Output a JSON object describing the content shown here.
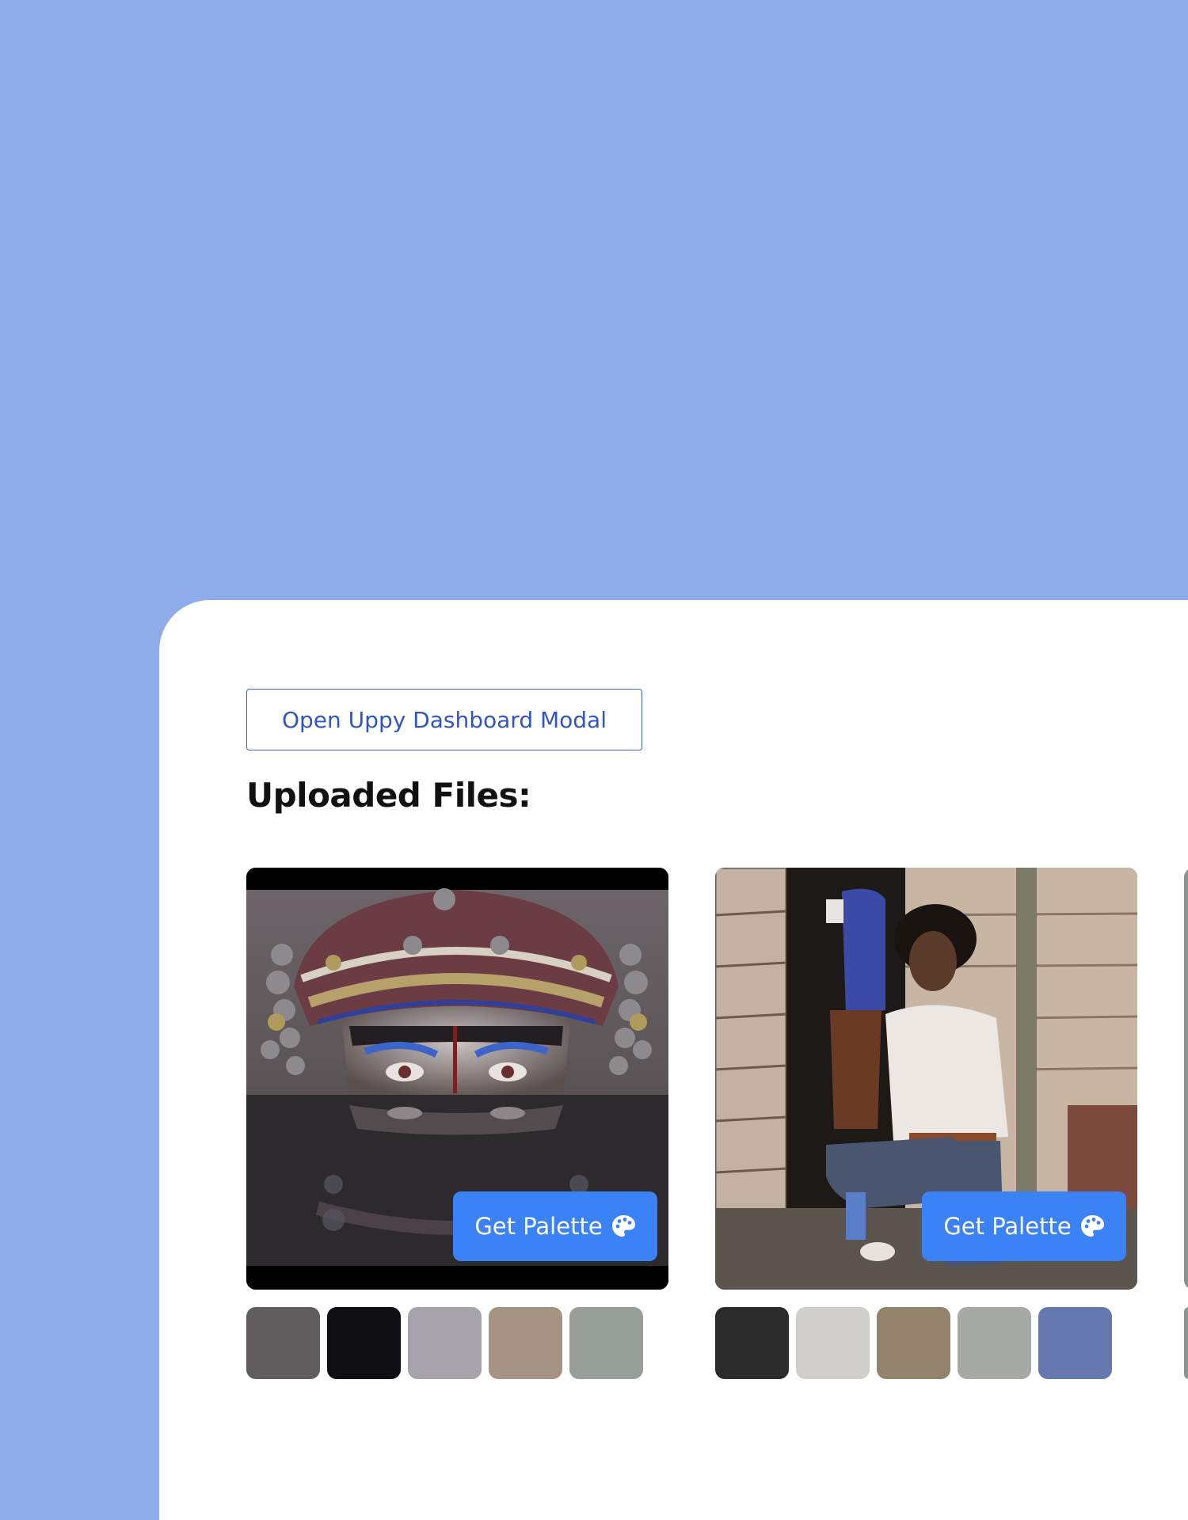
{
  "page": {
    "background_color": "#8facea",
    "panel_color": "#ffffff"
  },
  "dashboard_button": {
    "label": "Open Uppy Dashboard Modal",
    "accent": "#2f55c9"
  },
  "uploaded_files": {
    "title": "Uploaded Files:",
    "files": [
      {
        "image": "ornate-headdress-reflection",
        "button_label": "Get Palette",
        "button_icon": "palette-icon",
        "palette": [
          "#615d5e",
          "#0f0e13",
          "#a7a3ab",
          "#a59483",
          "#979f98"
        ]
      },
      {
        "image": "man-in-doorway",
        "button_label": "Get Palette",
        "button_icon": "palette-icon",
        "palette": [
          "#2b2b2b",
          "#d1cfcb",
          "#93836d",
          "#a5aaa4",
          "#6579b0"
        ]
      }
    ]
  },
  "accent_color": "#3b82f6"
}
